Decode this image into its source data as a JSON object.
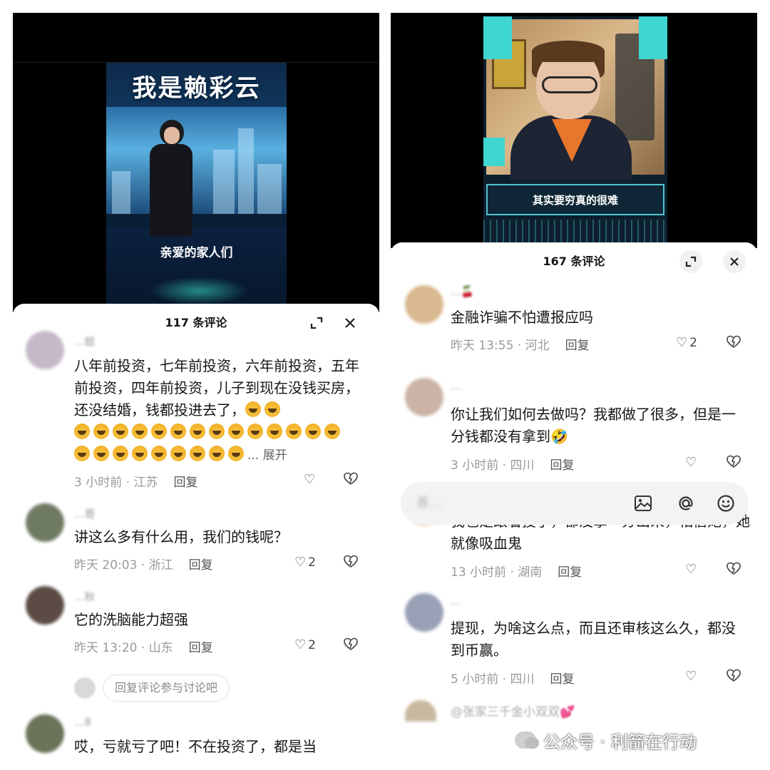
{
  "left": {
    "video": {
      "title": "我是赖彩云",
      "caption": "亲爱的家人们"
    },
    "sheet": {
      "title": "117 条评论",
      "expand_icon": "collapse-corners-icon",
      "close_icon": "close-icon"
    },
    "comments": [
      {
        "user": "...姐",
        "text_1": "八年前投资，七年前投资，六年前投资，五年前投资，四年前投资，儿子到现在没钱买房，还没结婚，钱都投进去了，",
        "emoji_count_line1": 2,
        "emoji_count_line2": 14,
        "emoji_count_line3": 9,
        "more": "... 展开",
        "time": "3 小时前",
        "location": "江苏",
        "reply": "回复",
        "likes": ""
      },
      {
        "user": "...哥",
        "text": "讲这么多有什么用，我们的钱呢？",
        "time": "昨天 20:03",
        "location": "浙江",
        "reply": "回复",
        "likes": "2"
      },
      {
        "user": "...秋",
        "text": "它的洗脑能力超强",
        "time": "昨天 13:20",
        "location": "山东",
        "reply": "回复",
        "likes": "2"
      },
      {
        "user": "...8",
        "text": "哎，亏就亏了吧！不在投资了，都是当",
        "time": "",
        "location": "",
        "reply": "",
        "likes": ""
      }
    ],
    "reply_prompt": "回复评论参与讨论吧"
  },
  "right": {
    "video": {
      "caption": "其实要穷真的很难"
    },
    "sheet": {
      "title": "167 条评论",
      "expand_icon": "collapse-corners-icon",
      "close_icon": "close-icon"
    },
    "comments": [
      {
        "user": "...🍒",
        "text": "金融诈骗不怕遭报应吗",
        "time": "昨天 13:55",
        "location": "河北",
        "reply": "回复",
        "likes": "2"
      },
      {
        "user": "...",
        "text": "你让我们如何去做吗？我都做了很多，但是一分钱都没有拿到🤣",
        "time": "3 小时前",
        "location": "四川",
        "reply": "回复",
        "likes": ""
      },
      {
        "user": "...",
        "text": "我也是跟着投了，都没拿一分出来，相信她，她就像吸血鬼",
        "time": "13 小时前",
        "location": "湖南",
        "reply": "回复",
        "likes": ""
      },
      {
        "user": "...",
        "text": "提现，为啥这么点，而且还审核这么久，都没到币赢。",
        "time": "5 小时前",
        "location": "四川",
        "reply": "回复",
        "likes": ""
      },
      {
        "user": "@张家三千金小双双💕",
        "text": "",
        "time": "",
        "location": "",
        "reply": "",
        "likes": ""
      }
    ],
    "input": {
      "placeholder": "善...",
      "icons": [
        "image-icon",
        "at-icon",
        "emoji-icon"
      ]
    }
  },
  "watermark": {
    "text": "公众号 · 利箭在行动"
  },
  "colors": {
    "text_primary": "#161616",
    "text_secondary": "#9a9a9a",
    "sheet_bg": "#ffffff",
    "video_bg": "#000000",
    "accent_cyan": "#3fd6d2"
  }
}
